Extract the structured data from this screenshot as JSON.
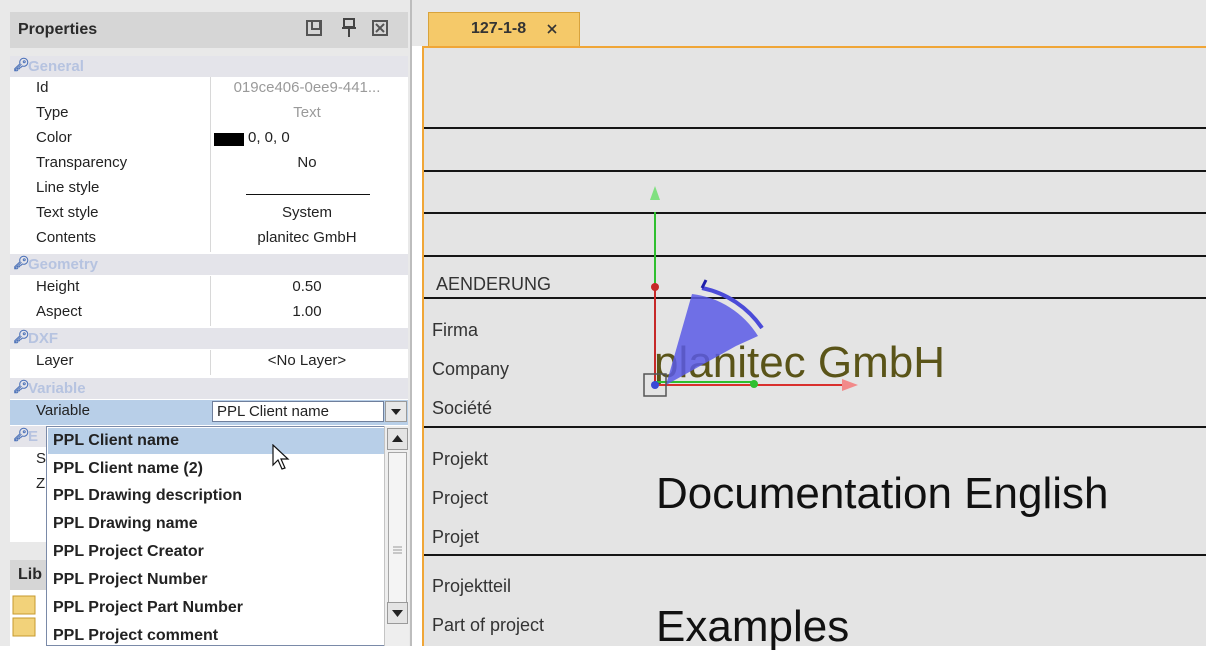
{
  "properties_panel": {
    "title": "Properties",
    "categories": {
      "general": "General",
      "geometry": "Geometry",
      "dxf": "DXF",
      "variable": "Variable",
      "hidden": "E"
    },
    "rows": {
      "id": {
        "name": "Id",
        "value": "019ce406-0ee9-441..."
      },
      "type": {
        "name": "Type",
        "value": "Text"
      },
      "color": {
        "name": "Color",
        "value": "0, 0, 0",
        "swatch": "#000000"
      },
      "transparency": {
        "name": "Transparency",
        "value": "No"
      },
      "line_style": {
        "name": "Line style"
      },
      "text_style": {
        "name": "Text style",
        "value": "System"
      },
      "contents": {
        "name": "Contents",
        "value": "planitec GmbH"
      },
      "height": {
        "name": "Height",
        "value": "0.50"
      },
      "aspect": {
        "name": "Aspect",
        "value": "1.00"
      },
      "layer": {
        "name": "Layer",
        "value": "<No Layer>"
      },
      "variable": {
        "name": "Variable",
        "value": "PPL Client name"
      }
    },
    "obscured_rows": [
      "S",
      "Z"
    ],
    "library_label": "Lib"
  },
  "dropdown": {
    "options": [
      "PPL Client name",
      "PPL Client name (2)",
      "PPL Drawing description",
      "PPL Drawing name",
      "PPL Project Creator",
      "PPL Project Number",
      "PPL Project Part Number",
      "PPL Project comment"
    ],
    "selected": "PPL Client name"
  },
  "tab": {
    "label": "127-1-8"
  },
  "drawing": {
    "labels": {
      "aenderung": "AENDERUNG",
      "firma": "Firma",
      "company": "Company",
      "societe": "Société",
      "projekt": "Projekt",
      "project": "Project",
      "projet": "Projet",
      "projektteil": "Projektteil",
      "part_of_project": "Part of project"
    },
    "client_text": "planitec GmbH",
    "project_text": "Documentation English",
    "part_text": "Examples"
  },
  "colors": {
    "tab_active": "#f5c969",
    "canvas_border": "#f0a637",
    "client_text": "#5a5418",
    "category_text": "#b6c3e0",
    "selection": "#b8cfe8"
  }
}
